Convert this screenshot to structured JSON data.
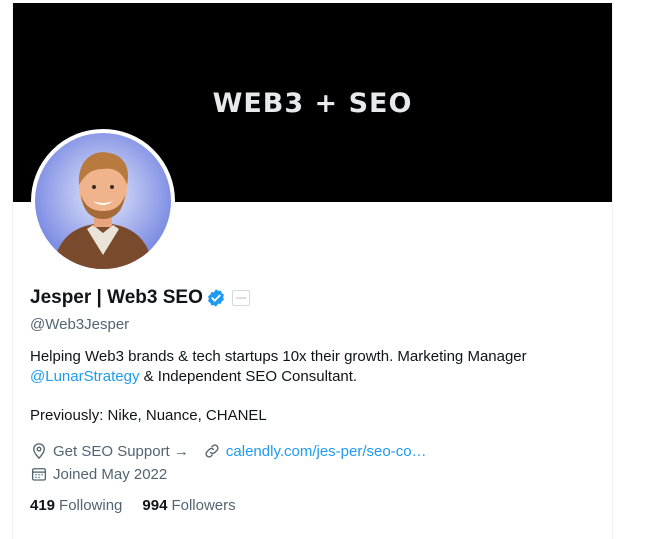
{
  "banner": {
    "text": "WEB3 + SEO"
  },
  "profile": {
    "name": "Jesper | Web3 SEO",
    "handle": "@Web3Jesper",
    "affiliate_badge": "LUNAR",
    "bio_line1": "Helping Web3 brands & tech startups 10x their growth. Marketing Manager",
    "bio_mention": "@LunarStrategy",
    "bio_line2_rest": " & Independent SEO Consultant.",
    "bio_previously": "Previously: Nike, Nuance, CHANEL",
    "location": "Get SEO Support →",
    "website": "calendly.com/jes-per/seo-co…",
    "joined": "Joined May 2022"
  },
  "stats": {
    "following_count": "419",
    "following_label": "Following",
    "followers_count": "994",
    "followers_label": "Followers"
  },
  "colors": {
    "accent": "#1d9bf0",
    "text": "#0f1419",
    "muted": "#536471",
    "banner": "#000000"
  }
}
